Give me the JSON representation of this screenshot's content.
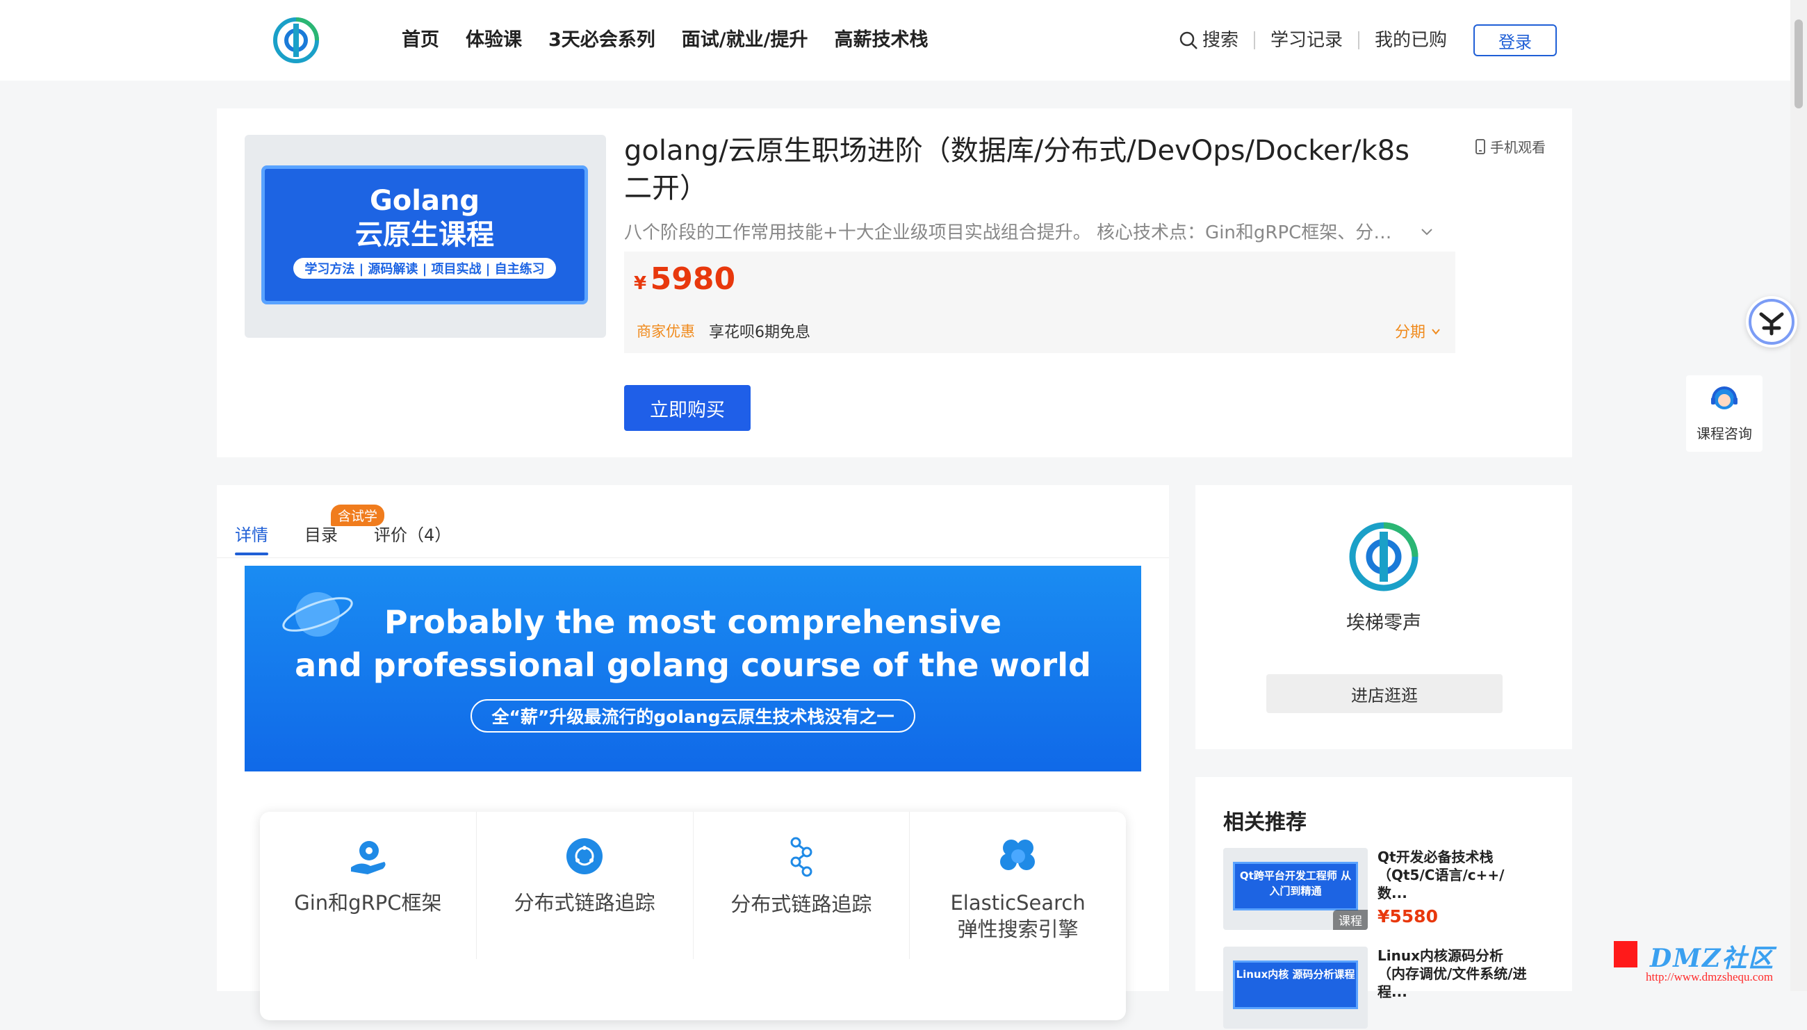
{
  "nav": {
    "items": [
      "首页",
      "体验课",
      "3天必会系列",
      "面试/就业/提升",
      "高薪技术栈"
    ],
    "search": "搜索",
    "history": "学习记录",
    "purchased": "我的已购",
    "login": "登录"
  },
  "course": {
    "title": "golang/云原生职场进阶（数据库/分布式/DevOps/Docker/k8s二开）",
    "mobile_watch": "手机观看",
    "description": "八个阶段的工作常用技能+十大企业级项目实战组合提升。 核心技术点：Gin和gRPC框架、分布式...",
    "currency": "¥",
    "price": "5980",
    "promo_tag": "商家优惠",
    "promo_text": "享花呗6期免息",
    "installment": "分期",
    "buy": "立即购买",
    "cover": {
      "line1": "Golang",
      "line2": "云原生课程",
      "tags": "学习方法 | 源码解读 | 项目实战 | 自主练习"
    }
  },
  "tabs": {
    "detail": "详情",
    "catalog": "目录",
    "reviews": "评价（4）",
    "trial_badge": "含试学"
  },
  "banner": {
    "line1": "Probably the most comprehensive",
    "line2": "and professional golang course of the world",
    "sub": "全“薪”升级最流行的golang云原生技术栈没有之一"
  },
  "features": [
    {
      "name": "Gin和gRPC框架",
      "icon": "gear-hand-icon"
    },
    {
      "name": "分布式链路追踪",
      "icon": "network-globe-icon"
    },
    {
      "name": "分布式链路追踪",
      "icon": "node-graph-icon"
    },
    {
      "name": "ElasticSearch\n弹性搜索引擎",
      "icon": "cluster-icon"
    }
  ],
  "shop": {
    "name": "埃梯零声",
    "enter": "进店逛逛"
  },
  "recommend": {
    "title": "相关推荐",
    "items": [
      {
        "thumb": "Qt跨平台开发工程师 从入门到精通",
        "badge": "课程",
        "name": "Qt开发必备技术栈（Qt5/C语言/c++/数...",
        "price": "¥5580"
      },
      {
        "thumb": "Linux内核 源码分析课程",
        "badge": "",
        "name": "Linux内核源码分析（内存调优/文件系统/进程...",
        "price": ""
      }
    ]
  },
  "sidebar": {
    "consult": "课程咨询"
  },
  "watermark": {
    "text": "DMZ社区",
    "url": "http://www.dmzshequ.com"
  },
  "colors": {
    "brand_blue": "#1f5fd6",
    "price_red": "#e8380d",
    "promo_orange": "#f08a1c"
  }
}
